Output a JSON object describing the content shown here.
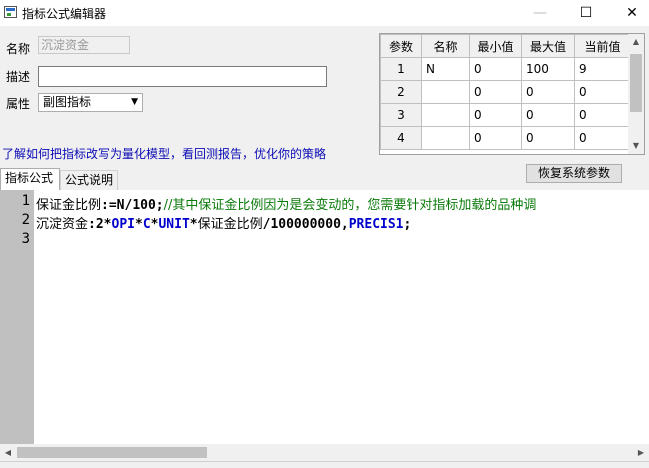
{
  "window": {
    "title": "指标公式编辑器",
    "minimize_glyph": "—",
    "maximize_glyph": "☐",
    "close_glyph": "✕"
  },
  "form": {
    "name_label": "名称",
    "name_value": "沉淀资金",
    "desc_label": "描述",
    "desc_value": "",
    "attr_label": "属性",
    "attr_value": "副图指标"
  },
  "link_text": "了解如何把指标改写为量化模型，看回测报告，优化你的策略",
  "params": {
    "headers": [
      "参数",
      "名称",
      "最小值",
      "最大值",
      "当前值"
    ],
    "rows": [
      {
        "idx": "1",
        "name": "N",
        "min": "0",
        "max": "100",
        "cur": "9"
      },
      {
        "idx": "2",
        "name": "",
        "min": "0",
        "max": "0",
        "cur": "0"
      },
      {
        "idx": "3",
        "name": "",
        "min": "0",
        "max": "0",
        "cur": "0"
      },
      {
        "idx": "4",
        "name": "",
        "min": "0",
        "max": "0",
        "cur": "0"
      }
    ]
  },
  "restore_button": "恢复系统参数",
  "tabs": [
    "指标公式",
    "公式说明"
  ],
  "editor": {
    "line_numbers": [
      "1",
      "2",
      "3"
    ],
    "line1": {
      "name": "保证金比例",
      "op": ":=N/100;",
      "comment": "//其中保证金比例因为是会变动的，您需要针对指标加载的品种调"
    },
    "line2": {
      "name": "沉淀资金",
      "p1": ":2*",
      "kw1": "OPI",
      "p2": "*",
      "kw2": "C",
      "p3": "*",
      "kw3": "UNIT",
      "p4": "*",
      "name2": "保证金比例",
      "p5": "/100000000,",
      "kw4": "PRECIS1",
      "p6": ";"
    }
  },
  "colors": {
    "link": "#0b0bb5",
    "keyword": "#0000cc",
    "comment": "#0a7a0a",
    "gutter": "#c0c0c0"
  }
}
